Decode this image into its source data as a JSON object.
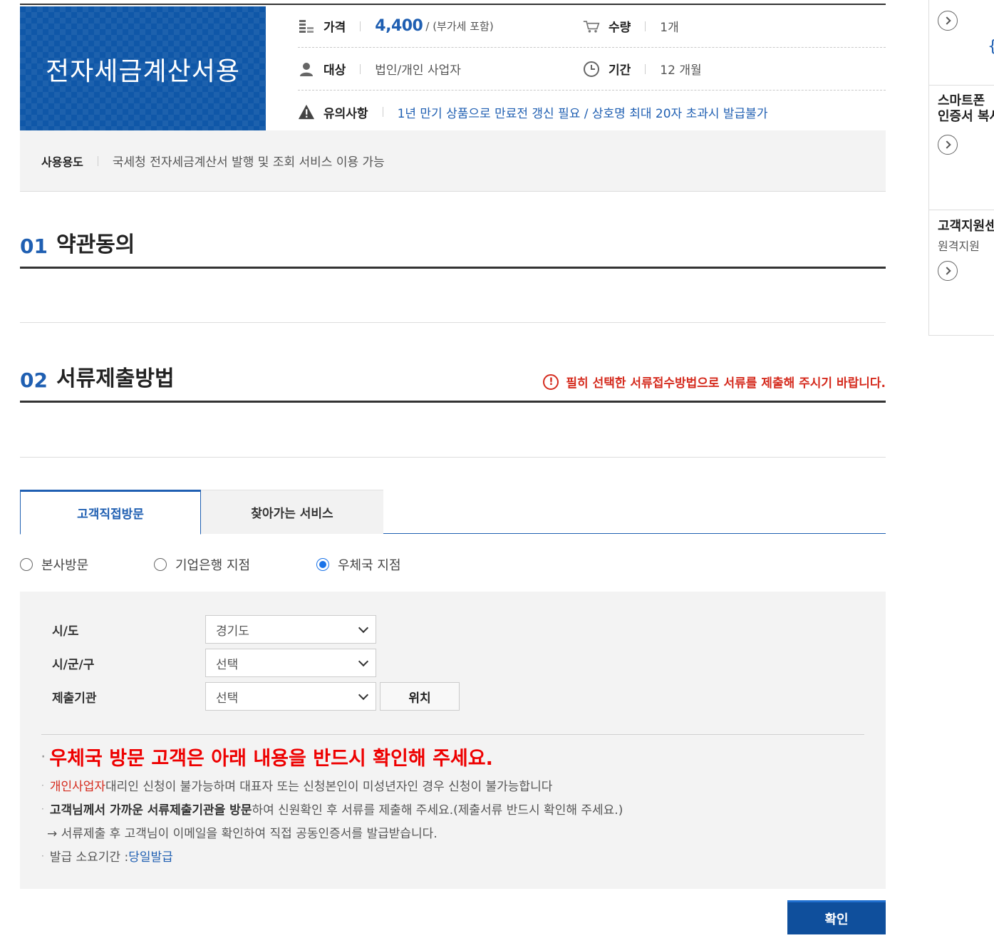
{
  "product": {
    "banner_title": "전자세금계산서용",
    "price_label": "가격",
    "price_value": "4,400",
    "price_note": "/ (부가세 포함)",
    "qty_label": "수량",
    "qty_value": "1개",
    "target_label": "대상",
    "target_value": "법인/개인 사업자",
    "period_label": "기간",
    "period_value": "12 개월",
    "notice_label": "유의사항",
    "notice_value": "1년 만기 상품으로 만료전 갱신 필요 / 상호명 최대 20자 초과시 발급불가",
    "usage_label": "사용용도",
    "usage_value": "국세청 전자세금계산서 발행 및 조회 서비스 이용 가능"
  },
  "sections": {
    "s1_num": "01",
    "s1_title": "약관동의",
    "s2_num": "02",
    "s2_title": "서류제출방법",
    "s2_warning": "필히 선택한 서류접수방법으로 서류를 제출해 주시기 바랍니다."
  },
  "tabs": [
    {
      "label": "고객직접방문",
      "active": true
    },
    {
      "label": "찾아가는 서비스",
      "active": false
    }
  ],
  "radios": [
    {
      "label": "본사방문",
      "checked": false
    },
    {
      "label": "기업은행 지점",
      "checked": false
    },
    {
      "label": "우체국 지점",
      "checked": true
    }
  ],
  "form": {
    "sido_label": "시/도",
    "sido_value": "경기도",
    "sigungu_label": "시/군/구",
    "sigungu_value": "선택",
    "agency_label": "제출기관",
    "agency_value": "선택",
    "location_button": "위치"
  },
  "notice": {
    "headline": "우체국 방문 고객은 아래 내용을 반드시 확인해 주세요.",
    "line1_red": "개인사업자",
    "line1_rest": "대리인 신청이 불가능하며 대표자 또는 신청본인이 미성년자인 경우 신청이 불가능합니다",
    "line2_bold": "고객님께서 가까운 서류제출기관을 방문",
    "line2_rest": "하여 신원확인 후 서류를 제출해 주세요.(제출서류 반드시 확인해 주세요.)",
    "line3": "→ 서류제출 후 고객님이 이메일을 확인하여 직접 공동인증서를 발급받습니다.",
    "line4_label": "발급 소요기간 : ",
    "line4_value": "당일발급"
  },
  "confirm_label": "확인",
  "sidebar": {
    "item2_title_l1": "스마트폰",
    "item2_title_l2": "인증서 복사",
    "item3_title": "고객지원센터",
    "item3_sub": "원격지원"
  },
  "colors": {
    "brand_blue": "#0f57a8",
    "accent_blue": "#1f5fb2",
    "warning_red": "#d52b1e",
    "radio_blue": "#1a73e8"
  },
  "icons": {
    "price": "coin-stack-icon",
    "qty": "cart-icon",
    "target": "person-icon",
    "period": "clock-icon",
    "notice": "warning-triangle-icon",
    "warning": "info-circle-icon",
    "select": "chevron-down-icon",
    "side_more": "circle-arrow-right-icon"
  }
}
